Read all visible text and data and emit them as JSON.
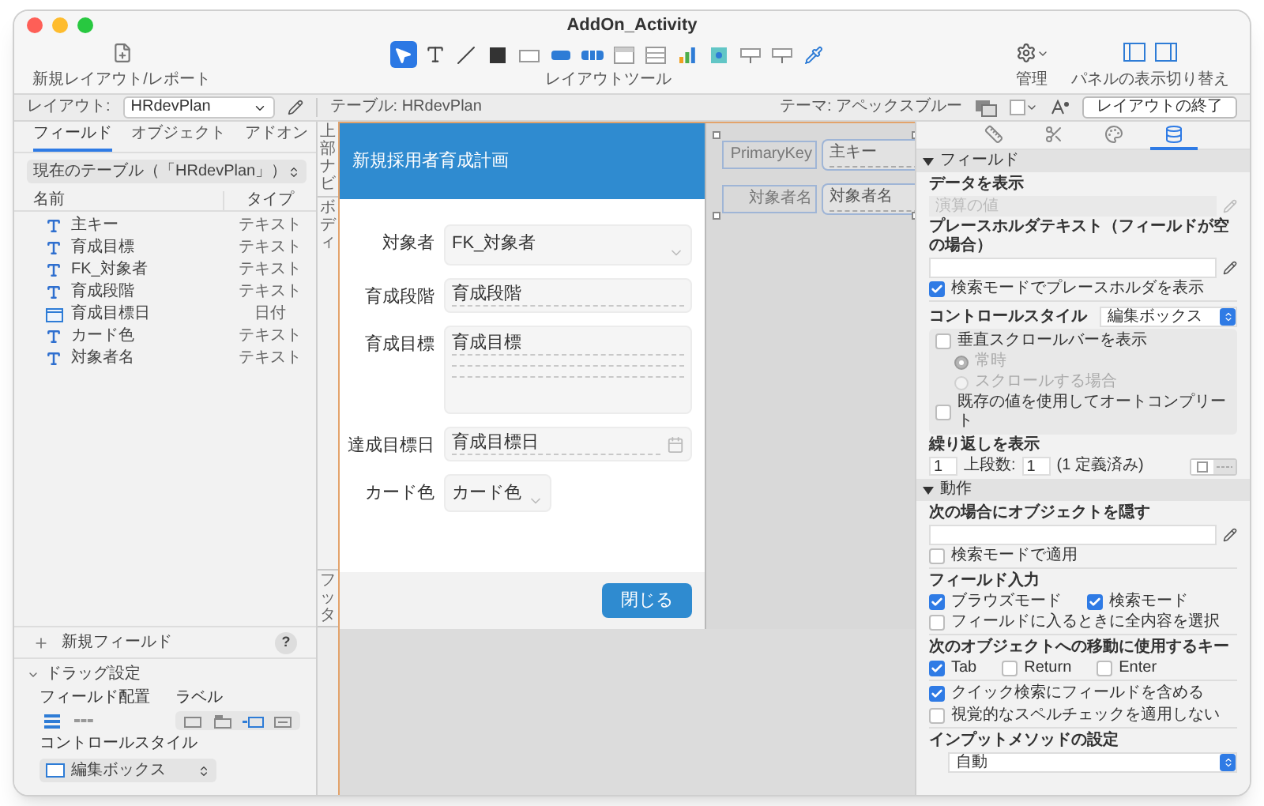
{
  "window": {
    "title": "AddOn_Activity"
  },
  "toolbar": {
    "new_layout": "新規レイアウト/レポート",
    "tools_label": "レイアウトツール",
    "manage": "管理",
    "panels": "パネルの表示切り替え",
    "tools": [
      {
        "kind": "pointer",
        "selected": true
      },
      {
        "kind": "text",
        "selected": false
      },
      {
        "kind": "line",
        "selected": false
      },
      {
        "kind": "shape",
        "selected": false
      },
      {
        "kind": "field",
        "selected": false
      },
      {
        "kind": "button",
        "selected": false
      },
      {
        "kind": "button-bar",
        "selected": false
      },
      {
        "kind": "popover",
        "selected": false
      },
      {
        "kind": "portal",
        "selected": false
      },
      {
        "kind": "chart",
        "selected": false
      },
      {
        "kind": "web-viewer",
        "selected": false
      },
      {
        "kind": "slot",
        "selected": false
      },
      {
        "kind": "slot",
        "selected": false
      },
      {
        "kind": "eyedropper",
        "selected": false
      }
    ]
  },
  "layout_bar": {
    "layout_label": "レイアウト:",
    "layout_value": "HRdevPlan",
    "table": "テーブル: HRdevPlan",
    "theme": "テーマ: アペックスブルー",
    "exit_button": "レイアウトの終了"
  },
  "left_panel": {
    "tabs": [
      {
        "label": "フィールド",
        "selected": true
      },
      {
        "label": "オブジェクト",
        "selected": false
      },
      {
        "label": "アドオン",
        "selected": false
      }
    ],
    "table_selector": "現在のテーブル（「HRdevPlan」）",
    "columns": [
      "名前",
      "タイプ"
    ],
    "fields": [
      {
        "name": "主キー",
        "type": "テキスト",
        "kind": "text"
      },
      {
        "name": "育成目標",
        "type": "テキスト",
        "kind": "text"
      },
      {
        "name": "FK_対象者",
        "type": "テキスト",
        "kind": "text"
      },
      {
        "name": "育成段階",
        "type": "テキスト",
        "kind": "text"
      },
      {
        "name": "育成目標日",
        "type": "日付",
        "kind": "date"
      },
      {
        "name": "カード色",
        "type": "テキスト",
        "kind": "text"
      },
      {
        "name": "対象者名",
        "type": "テキスト",
        "kind": "text"
      }
    ],
    "new_field": "新規フィールド",
    "help": "?",
    "drag": {
      "title": "ドラッグ設定",
      "expanded": true,
      "placement_label": "フィールド配置",
      "label_label": "ラベル",
      "placement": [
        {
          "kind": "vertical",
          "selected": true
        },
        {
          "kind": "horizontal",
          "selected": false
        }
      ],
      "label_positions": [
        {
          "kind": "none",
          "selected": false
        },
        {
          "kind": "top",
          "selected": false
        },
        {
          "kind": "left",
          "selected": true
        },
        {
          "kind": "right",
          "selected": false
        }
      ],
      "control_style_label": "コントロールスタイル",
      "control_style_value": "編集ボックス"
    }
  },
  "parts": [
    {
      "label": "上部ナビ",
      "kind": "header"
    },
    {
      "label": "ボディ",
      "kind": "body"
    },
    {
      "label": "フッタ",
      "kind": "footer"
    }
  ],
  "card": {
    "title": "新規採用者育成計画",
    "close_button": "閉じる",
    "fields": [
      {
        "label": "対象者",
        "value": "FK_対象者",
        "kind": "dropdown"
      },
      {
        "label": "育成段階",
        "value": "育成段階",
        "kind": "text"
      },
      {
        "label": "育成目標",
        "value": "育成目標",
        "kind": "textarea"
      },
      {
        "label": "達成目標日",
        "value": "育成目標日",
        "kind": "date"
      },
      {
        "label": "カード色",
        "value": "カード色",
        "kind": "popup"
      }
    ]
  },
  "loose_fields": [
    {
      "label": "PrimaryKey",
      "value": "主キー"
    },
    {
      "label": "対象者名",
      "value": "対象者名"
    }
  ],
  "inspector": {
    "tabs": [
      {
        "kind": "position",
        "selected": false
      },
      {
        "kind": "styles",
        "selected": false
      },
      {
        "kind": "appearance",
        "selected": false
      },
      {
        "kind": "data",
        "selected": true
      }
    ],
    "field_section": {
      "title": "フィールド",
      "expanded": true,
      "display_data_label": "データを表示",
      "display_data_placeholder": "演算の値",
      "placeholder_label": "プレースホルダテキスト（フィールドが空の場合）",
      "show_in_find": {
        "label": "検索モードでプレースホルダを表示",
        "checked": true
      },
      "control_style_label": "コントロールスタイル",
      "control_style_value": "編集ボックス",
      "options": [
        {
          "kind": "checkbox",
          "label": "垂直スクロールバーを表示",
          "checked": false,
          "disabled": false
        },
        {
          "kind": "radio",
          "label": "常時",
          "selected": true,
          "disabled": true
        },
        {
          "kind": "radio",
          "label": "スクロールする場合",
          "selected": false,
          "disabled": true
        },
        {
          "kind": "checkbox",
          "label": "既存の値を使用してオートコンプリート",
          "checked": false,
          "disabled": false
        }
      ],
      "repeat_label": "繰り返しを表示",
      "orientation": [
        {
          "kind": "vertical",
          "selected": true
        },
        {
          "kind": "horizontal",
          "selected": false
        }
      ],
      "repeat_from": "1",
      "repeat_from_label": "上段数:",
      "repeat_count": "1",
      "repeat_defined": "(1 定義済み)"
    },
    "behavior_section": {
      "title": "動作",
      "expanded": true,
      "hide_label": "次の場合にオブジェクトを隠す",
      "hide_in_find": {
        "label": "検索モードで適用",
        "checked": false
      },
      "entry_label": "フィールド入力",
      "entry": [
        {
          "label": "ブラウズモード",
          "checked": true
        },
        {
          "label": "検索モード",
          "checked": true
        }
      ],
      "select_all": {
        "label": "フィールドに入るときに全内容を選択",
        "checked": false
      },
      "keys_label": "次のオブジェクトへの移動に使用するキー",
      "keys": [
        {
          "label": "Tab",
          "checked": true
        },
        {
          "label": "Return",
          "checked": false
        },
        {
          "label": "Enter",
          "checked": false
        }
      ],
      "extras": [
        {
          "label": "クイック検索にフィールドを含める",
          "checked": true
        },
        {
          "label": "視覚的なスペルチェックを適用しない",
          "checked": false
        }
      ],
      "input_method_label": "インプットメソッドの設定",
      "input_method_value": "自動"
    }
  }
}
